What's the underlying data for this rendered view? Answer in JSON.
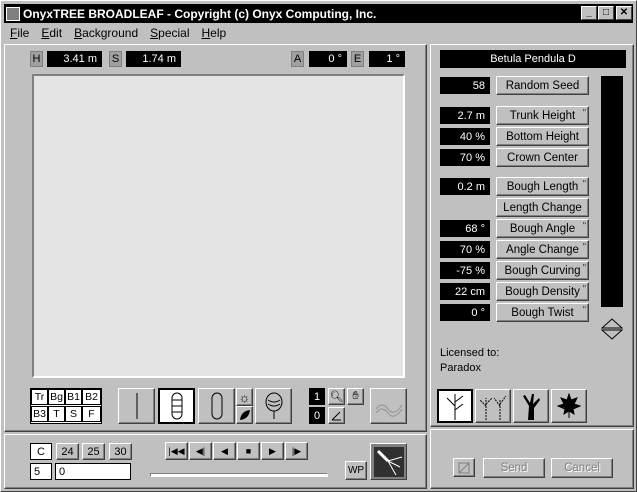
{
  "window": {
    "title": "OnyxTREE BROADLEAF - Copyright (c) Onyx Computing, Inc."
  },
  "menu": [
    "File",
    "Edit",
    "Background",
    "Special",
    "Help"
  ],
  "top_fields": {
    "h_label": "H",
    "h_value": "3.41 m",
    "s_label": "S",
    "s_value": "1.74 m",
    "a_label": "A",
    "a_value": "0 °",
    "e_label": "E",
    "e_value": "1 °"
  },
  "species": "Betula Pendula D",
  "params": [
    {
      "value": "58",
      "label": "Random Seed"
    },
    {
      "value": "2.7 m",
      "label": "Trunk Height"
    },
    {
      "value": "40 %",
      "label": "Bottom Height"
    },
    {
      "value": "70 %",
      "label": "Crown Center"
    },
    {
      "value": "0.2 m",
      "label": "Bough Length"
    },
    {
      "value": "",
      "label": "Length Change"
    },
    {
      "value": "68 °",
      "label": "Bough Angle"
    },
    {
      "value": "70 %",
      "label": "Angle Change"
    },
    {
      "value": "-75 %",
      "label": "Bough Curving"
    },
    {
      "value": "22 cm",
      "label": "Bough Density"
    },
    {
      "value": "0 °",
      "label": "Bough Twist"
    }
  ],
  "license": {
    "label": "Licensed to:",
    "name": "Paradox"
  },
  "layer_toggles": [
    "Tr",
    "Bg",
    "B1",
    "B2",
    "B3",
    "T",
    "S",
    "F"
  ],
  "counters": {
    "top": "1",
    "bottom": "0"
  },
  "frame_rates": [
    "C",
    "24",
    "25",
    "30"
  ],
  "frame_fields": {
    "left": "5",
    "right": "0"
  },
  "wp_label": "WP",
  "footer_buttons": {
    "send": "Send",
    "cancel": "Cancel"
  }
}
